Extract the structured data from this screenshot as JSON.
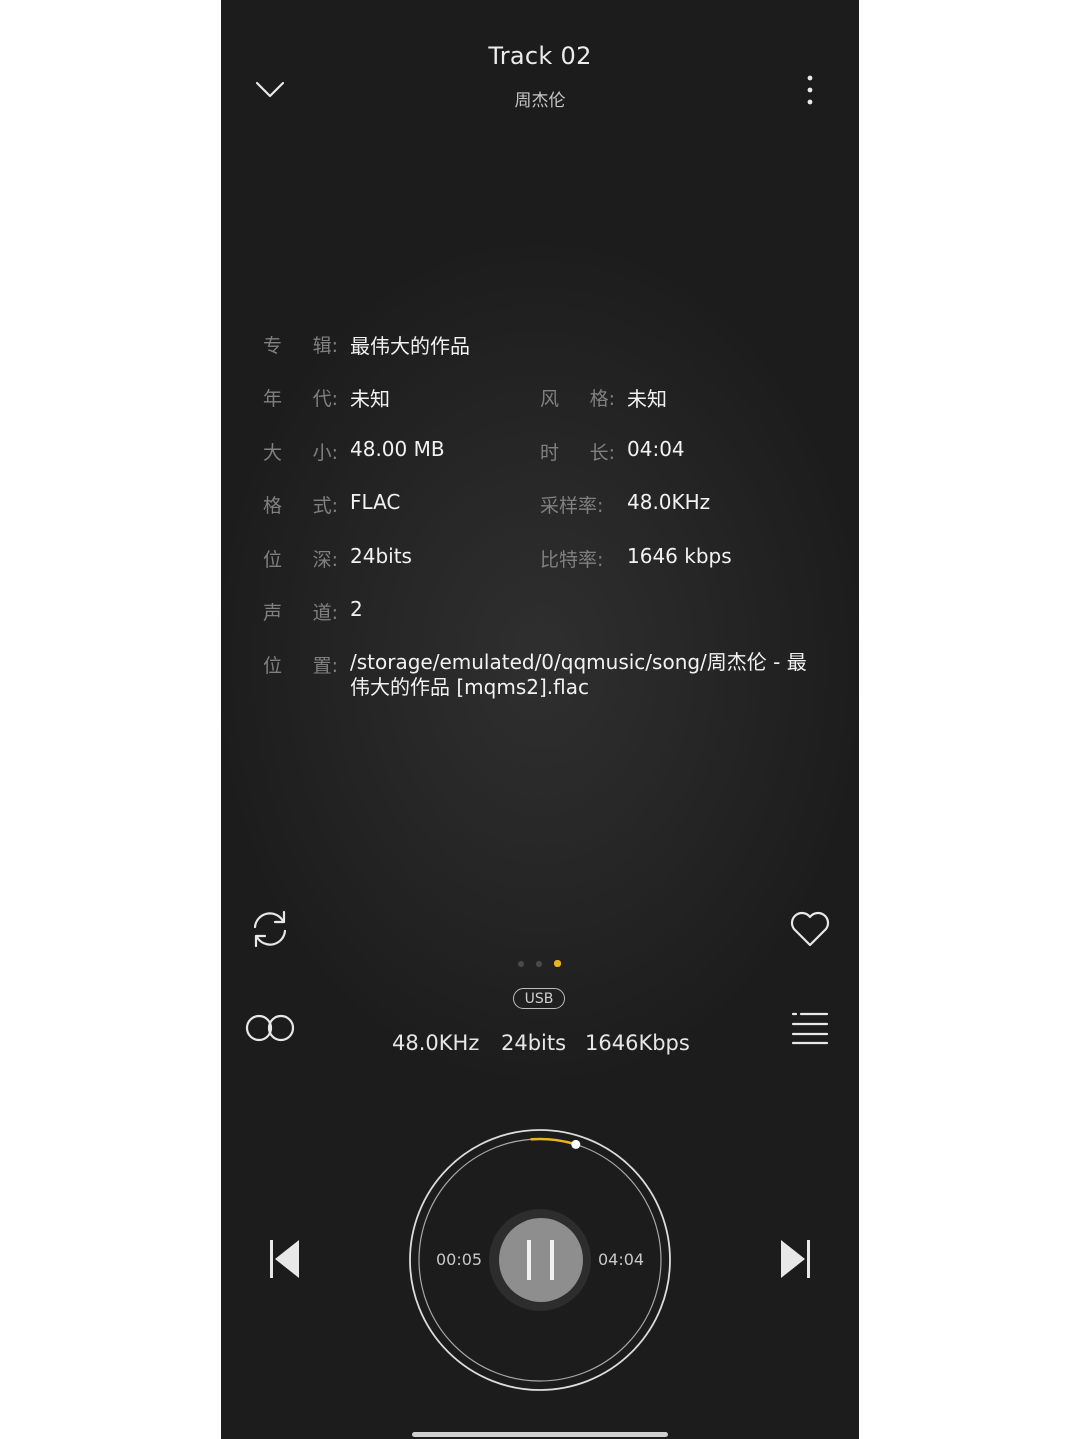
{
  "header": {
    "title": "Track 02",
    "artist": "周杰伦",
    "back_icon": "chevron-down-icon",
    "menu_icon": "more-vertical-icon"
  },
  "info": {
    "album_label": [
      "专",
      "辑:"
    ],
    "album_value": "最伟大的作品",
    "year_label": [
      "年",
      "代:"
    ],
    "year_value": "未知",
    "genre_label": [
      "风",
      "格:"
    ],
    "genre_value": "未知",
    "size_label": [
      "大",
      "小:"
    ],
    "size_value": "48.00 MB",
    "duration_label": [
      "时",
      "长:"
    ],
    "duration_value": "04:04",
    "format_label": [
      "格",
      "式:"
    ],
    "format_value": "FLAC",
    "samplerate_label": "采样率:",
    "samplerate_value": "48.0KHz",
    "bitdepth_label": [
      "位",
      "深:"
    ],
    "bitdepth_value": "24bits",
    "bitrate_label": "比特率:",
    "bitrate_value": "1646 kbps",
    "channels_label": [
      "声",
      "道:"
    ],
    "channels_value": "2",
    "location_label": [
      "位",
      "置:"
    ],
    "location_value": "/storage/emulated/0/qqmusic/song/周杰伦 - 最伟大的作品 [mqms2].flac"
  },
  "controls": {
    "repeat_icon": "repeat-icon",
    "favorite_icon": "heart-icon",
    "effect_icon": "sound-effect-icon",
    "playlist_icon": "playlist-icon",
    "page_count": 3,
    "active_page": 3,
    "output_badge": "USB",
    "output_samplerate": "48.0KHz",
    "output_bitdepth": "24bits",
    "output_bitrate": "1646Kbps",
    "current_time": "00:05",
    "total_time": "04:04",
    "progress": 0.02,
    "prev_icon": "skip-previous-icon",
    "pause_icon": "pause-icon",
    "next_icon": "skip-next-icon"
  },
  "colors": {
    "accent": "#e8b420",
    "background": "#232323"
  }
}
